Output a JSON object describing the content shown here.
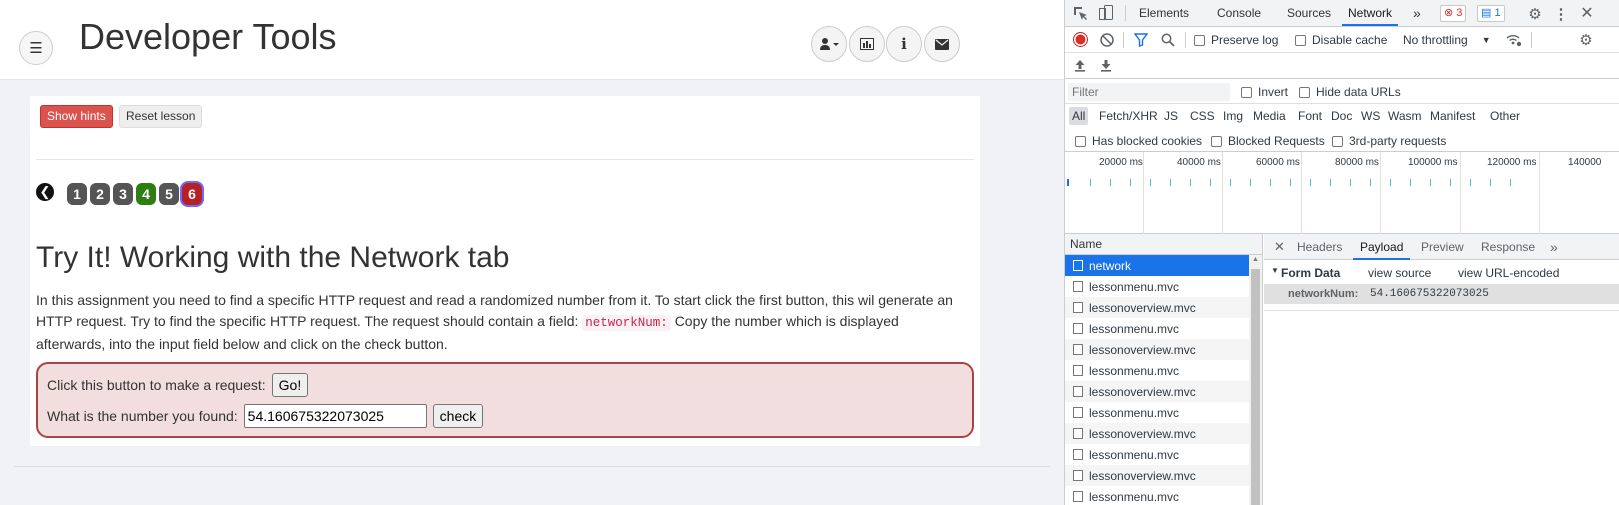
{
  "page": {
    "title": "Developer Tools",
    "hints_label": "Show hints",
    "reset_label": "Reset lesson",
    "page_numbers": [
      "1",
      "2",
      "3",
      "4",
      "5",
      "6"
    ],
    "lesson_heading": "Try It! Working with the Network tab",
    "lesson_desc_part1": "In this assignment you need to find a specific HTTP request and read a randomized number from it. To start click the first button, this wil generate an HTTP request. Try to find the specific HTTP request. The request should contain a field:",
    "lesson_desc_code": "networkNum:",
    "lesson_desc_part2": "Copy the number which is displayed afterwards, into the input field below and click on the check button.",
    "form": {
      "request_label": "Click this button to make a request:",
      "go_label": "Go!",
      "number_label": "What is the number you found:",
      "number_value": "54.160675322073025",
      "check_label": "check"
    }
  },
  "devtools": {
    "tabs": [
      "Elements",
      "Console",
      "Sources",
      "Network"
    ],
    "more_tabs": "»",
    "errors_count": "3",
    "messages_count": "1",
    "toolbar": {
      "preserve_log": "Preserve log",
      "disable_cache": "Disable cache",
      "throttling": "No throttling"
    },
    "filter_placeholder": "Filter",
    "invert": "Invert",
    "hide_data_urls": "Hide data URLs",
    "types": [
      "All",
      "Fetch/XHR",
      "JS",
      "CSS",
      "Img",
      "Media",
      "Font",
      "Doc",
      "WS",
      "Wasm",
      "Manifest",
      "Other"
    ],
    "blocked_cookies": "Has blocked cookies",
    "blocked_requests": "Blocked Requests",
    "third_party": "3rd-party requests",
    "overview_labels": [
      "20000 ms",
      "40000 ms",
      "60000 ms",
      "80000 ms",
      "100000 ms",
      "120000 ms",
      "140000"
    ],
    "list_header": "Name",
    "requests": [
      "network",
      "lessonmenu.mvc",
      "lessonoverview.mvc",
      "lessonmenu.mvc",
      "lessonoverview.mvc",
      "lessonmenu.mvc",
      "lessonoverview.mvc",
      "lessonmenu.mvc",
      "lessonoverview.mvc",
      "lessonmenu.mvc",
      "lessonoverview.mvc",
      "lessonmenu.mvc"
    ],
    "detail_tabs": [
      "Headers",
      "Payload",
      "Preview",
      "Response"
    ],
    "detail_more": "»",
    "form_data_label": "Form Data",
    "view_source": "view source",
    "view_url_encoded": "view URL-encoded",
    "payload_key": "networkNum:",
    "payload_value": "54.160675322073025"
  },
  "colors": {
    "accent": "#1a73e8",
    "danger": "#d9534f",
    "page_active": "#b92025",
    "page_done": "#2e7d13",
    "page_default": "#555555"
  }
}
